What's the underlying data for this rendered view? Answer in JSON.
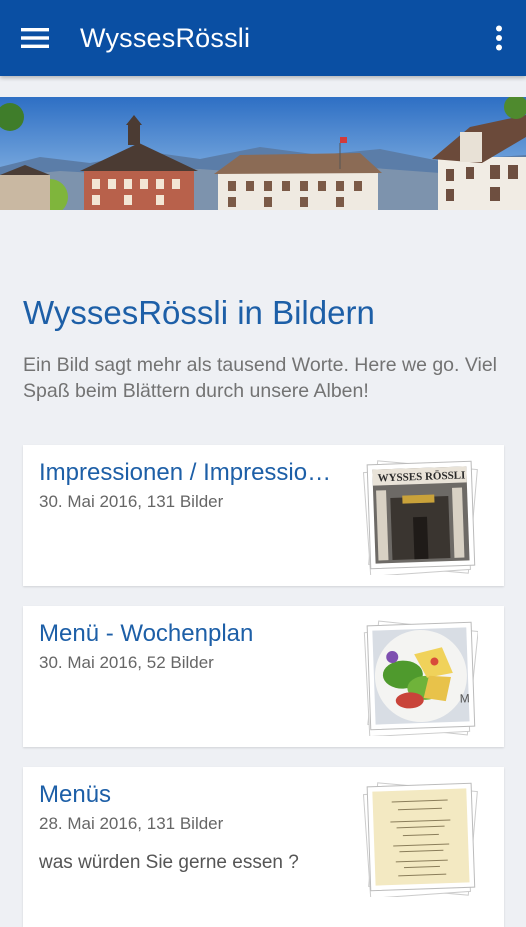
{
  "app": {
    "title": "WyssesRössli"
  },
  "hero": {
    "alt_icon": "hotel-panorama-image"
  },
  "gallery": {
    "heading": "WyssesRössli in Bildern",
    "description": "Ein Bild sagt mehr als tausend Worte. Here we go. Viel Spaß beim Blättern durch unsere Alben!"
  },
  "albums": [
    {
      "title": "Impressionen / Impressionen",
      "meta": "30. Mai 2016, 131 Bilder",
      "description": "",
      "thumb_icon": "hotel-entrance-photo"
    },
    {
      "title": "Menü - Wochenplan",
      "meta": "30. Mai 2016, 52 Bilder",
      "description": "",
      "thumb_icon": "salad-plate-photo"
    },
    {
      "title": "Menüs",
      "meta": "28. Mai 2016, 131 Bilder",
      "description": "was würden Sie gerne essen ?",
      "thumb_icon": "menu-card-photo"
    }
  ],
  "colors": {
    "appbar": "#0a4fa3",
    "accent_text": "#1d5fa7",
    "background": "#eef0f4"
  }
}
